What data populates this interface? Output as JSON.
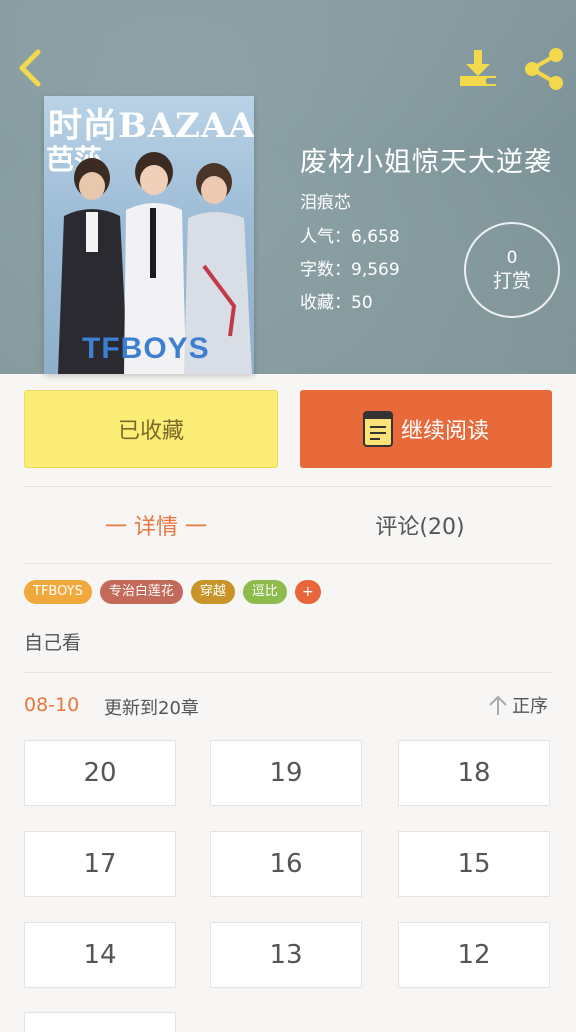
{
  "header": {
    "back_icon": "chevron-left-icon",
    "download_icon": "download-icon",
    "share_icon": "share-icon"
  },
  "book": {
    "cover_text_magazine": "时尚BAZAAR",
    "cover_text_sub": "芭莎",
    "cover_text_brand": "TFBOYS",
    "title": "废材小姐惊天大逆袭",
    "author": "泪痕芯",
    "popularity": "人气：6,658",
    "word_count": "字数：9,569",
    "favorites": "收藏：50"
  },
  "reward": {
    "count": "0",
    "label": "打赏"
  },
  "actions": {
    "favorited_label": "已收藏",
    "continue_label": "继续阅读"
  },
  "tabs": {
    "detail": "一 详情 一",
    "comments": "评论(20)"
  },
  "tags": [
    {
      "label": "TFBOYS",
      "color": "#f1a93e"
    },
    {
      "label": "专治白莲花",
      "color": "#c46a5a"
    },
    {
      "label": "穿越",
      "color": "#c9952a"
    },
    {
      "label": "逗比",
      "color": "#8dbb4c"
    }
  ],
  "tag_add": "+",
  "description": "自己看",
  "update": {
    "date": "08-10",
    "text": "更新到20章",
    "sort_label": "正序"
  },
  "chapters": [
    "20",
    "19",
    "18",
    "17",
    "16",
    "15",
    "14",
    "13",
    "12"
  ]
}
